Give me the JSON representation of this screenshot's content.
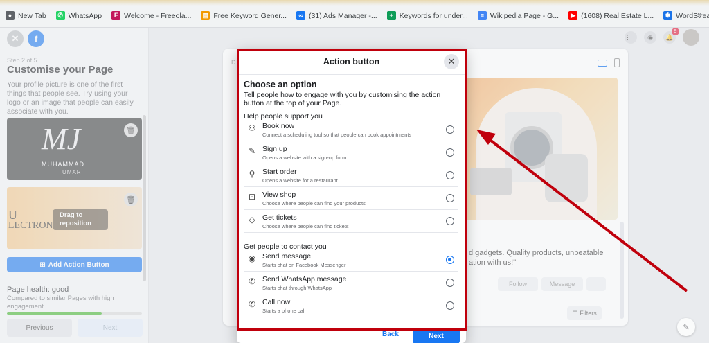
{
  "bookmarks": [
    {
      "label": "New Tab",
      "icon": "globe-icon",
      "color": "#5f6368",
      "glyph": "●"
    },
    {
      "label": "WhatsApp",
      "icon": "whatsapp-icon",
      "color": "#25d366",
      "glyph": "✆"
    },
    {
      "label": "Welcome - Freeola...",
      "icon": "freeola-icon",
      "color": "#c2185b",
      "glyph": "F"
    },
    {
      "label": "Free Keyword Gener...",
      "icon": "keyword-icon",
      "color": "#f29900",
      "glyph": "▤"
    },
    {
      "label": "(31) Ads Manager -...",
      "icon": "meta-icon",
      "color": "#1877f2",
      "glyph": "∞"
    },
    {
      "label": "Keywords for under...",
      "icon": "sheets-icon",
      "color": "#0f9d58",
      "glyph": "+"
    },
    {
      "label": "Wikipedia Page - G...",
      "icon": "docs-icon",
      "color": "#4285f4",
      "glyph": "≡"
    },
    {
      "label": "(1608) Real Estate L...",
      "icon": "youtube-icon",
      "color": "#ff0000",
      "glyph": "▶"
    },
    {
      "label": "WordStream | Free...",
      "icon": "wordstream-icon",
      "color": "#1a73e8",
      "glyph": "✱"
    }
  ],
  "bookmarks_more": "»",
  "sidebar": {
    "step": "Step 2 of 5",
    "title": "Customise your Page",
    "description": "Your profile picture is one of the first things that people see. Try using your logo or an image that people can easily associate with you.",
    "profile_mono": "MJ",
    "profile_name": "MUHAMMAD",
    "profile_name2": "UMAR",
    "cover_text1": "U",
    "cover_text2": "LECTRON",
    "drag_label": "Drag to reposition",
    "add_action_label": "Add Action Button",
    "health_title": "Page health: good",
    "health_desc": "Compared to similar Pages with high engagement.",
    "health_level": 0.7,
    "prev_label": "Previous",
    "next_label": "Next"
  },
  "preview": {
    "tab_label": "D",
    "text": "d gadgets. Quality products, unbeatable ation with us!\"",
    "btn1": "Follow",
    "btn2": "Message",
    "filter_label": "Filters"
  },
  "notifications_count": "9",
  "modal": {
    "title": "Action button",
    "heading": "Choose an option",
    "description": "Tell people how to engage with you by customising the action button at the top of your Page.",
    "section1": "Help people support you",
    "options1": [
      {
        "label": "Book now",
        "sub": "Connect a scheduling tool so that people can book appointments",
        "icon": "calendar-person-icon",
        "glyph": "⚇",
        "selected": false
      },
      {
        "label": "Sign up",
        "sub": "Opens a website with a sign-up form",
        "icon": "pencil-icon",
        "glyph": "✎",
        "selected": false
      },
      {
        "label": "Start order",
        "sub": "Opens a website for a restaurant",
        "icon": "utensils-icon",
        "glyph": "⚲",
        "selected": false
      },
      {
        "label": "View shop",
        "sub": "Choose where people can find your products",
        "icon": "shop-icon",
        "glyph": "⊡",
        "selected": false
      },
      {
        "label": "Get tickets",
        "sub": "Choose where people can find tickets",
        "icon": "ticket-icon",
        "glyph": "◇",
        "selected": false
      }
    ],
    "section2": "Get people to contact you",
    "options2": [
      {
        "label": "Send message",
        "sub": "Starts chat on Facebook Messenger",
        "icon": "messenger-icon",
        "glyph": "◉",
        "selected": true
      },
      {
        "label": "Send WhatsApp message",
        "sub": "Starts chat through WhatsApp",
        "icon": "whatsapp-icon",
        "glyph": "✆",
        "selected": false
      },
      {
        "label": "Call now",
        "sub": "Starts a phone call",
        "icon": "phone-icon",
        "glyph": "✆",
        "selected": false
      }
    ],
    "back_label": "Back",
    "next_label": "Next"
  },
  "colors": {
    "accent": "#1877f2",
    "annotation_red": "#c0000c"
  }
}
